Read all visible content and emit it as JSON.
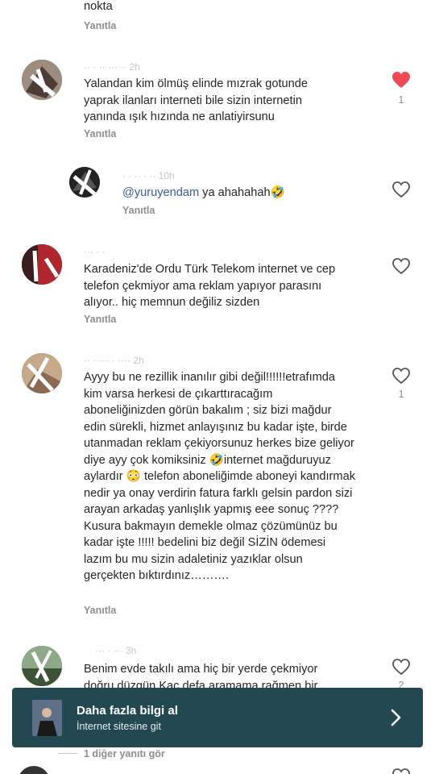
{
  "reply_label": "Yanıtla",
  "top_fragment": {
    "text": "nokta",
    "reply": "Yanıtla"
  },
  "comments": [
    {
      "username": "·· · ·· ··· ·· 2h",
      "text": "Yalandan kim ölmüş elinde mızrak gotunde yaprak ilanları interneti bile sizin internetin yanında ışık hızında ne anlatiyirsunu",
      "reply": "Yanıtla",
      "liked": true,
      "like_count": "1",
      "avatar_color": "#6b5e58"
    },
    {
      "username": "· · ·· · ·· 10h",
      "mention": "@yuruyendam",
      "text": " ya ahahahah🤣",
      "reply": "Yanıtla",
      "liked": false,
      "like_count": "",
      "avatar_color": "#3a3a3a"
    },
    {
      "username": "··· · ·",
      "text": "Karadeniz'de Ordu Türk Telekom internet ve cep telefon çekmiyor ama reklam yapıyor parasını alıyor.. hiç memnun değiliz sizden",
      "reply": "Yanıtla",
      "liked": false,
      "like_count": "",
      "avatar_color": "#b0262d"
    },
    {
      "username": "·· ····· · ···· 2h",
      "text": "Ayyy bu ne rezillik inanılır gibi değil!!!!!!etrafımda kim varsa herkesi de çıkarttıracağım aboneliğinizden görün bakalım ; siz bizi mağdur edin sürekli, hizmet anlayışınız bu kadar işte, birde utanmadan reklam çekiyorsunuz herkes bize geliyor diye ayy çok komiksiniz 🤣internet mağduruyuz aylardır 😳 telefon aboneliğimde aboneyi kandırmak nedir ya onay verdirin fatura farklı gelsin pardon sizi arayan arkadaş yanlışlık yapmış  eee sonuç ???? Kusura bakmayın demekle olmaz çözümünüz bu kadar işte !!!!! bedelini biz değil SİZİN ödemesi lazım bu mu sizin adaletiniz yazıklar olsun gerçekten bıktırdınız……….",
      "reply": "Yanıtla",
      "liked": false,
      "like_count": "1",
      "avatar_color": "#a8856a"
    },
    {
      "username": "··· · ··· 3h",
      "text": "Benim evde takılı ama hiç bir yerde çekmiyor doğru düzgün Kaç defa aramama rağmen bir",
      "reply": "",
      "liked": false,
      "like_count": "2",
      "avatar_color": "#5b6b52"
    }
  ],
  "banner": {
    "title": "Daha fazla bilgi al",
    "subtitle": "İnternet sitesine git",
    "bg_color": "#244852"
  },
  "more_replies": "1 diğer yanıtı gör",
  "colors": {
    "like_red": "#ed4956",
    "muted": "#8e8e8e",
    "mention": "#3b5b9a"
  }
}
